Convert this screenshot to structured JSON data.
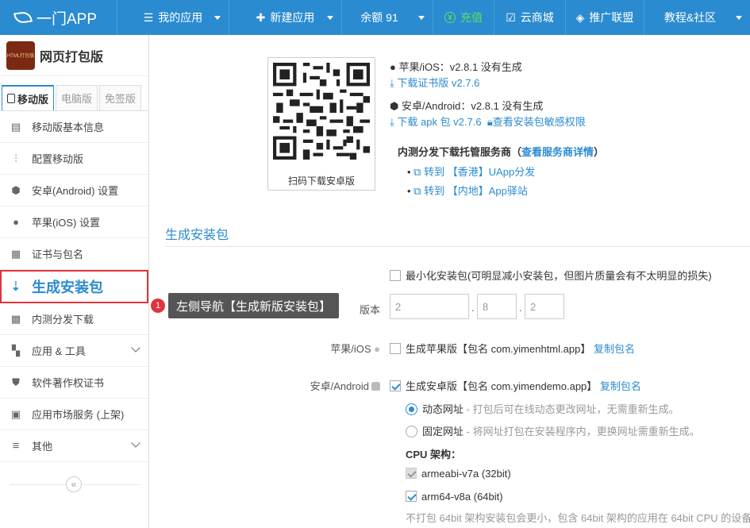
{
  "topbar": {
    "brand": "一门APP",
    "nav": [
      {
        "label": "我的应用",
        "icon": "menu-icon"
      },
      {
        "label": "新建应用",
        "icon": "plus-icon"
      },
      {
        "label": "余额 91",
        "icon": ""
      },
      {
        "label": "充值",
        "icon": "yen-icon"
      },
      {
        "label": "云商城",
        "icon": "shop-icon"
      },
      {
        "label": "推广联盟",
        "icon": "diamond-icon"
      },
      {
        "label": "教程&社区",
        "icon": ""
      }
    ],
    "recharge_color": "#5ddf5a"
  },
  "sidebar": {
    "app_icon_text": "HTML打包版",
    "app_name": "网页打包版",
    "tabs": [
      "移动版",
      "电脑版",
      "免签版"
    ],
    "items": [
      {
        "label": "移动版基本信息"
      },
      {
        "label": "配置移动版"
      },
      {
        "label": "安卓(Android) 设置"
      },
      {
        "label": "苹果(iOS) 设置"
      },
      {
        "label": "证书与包名"
      },
      {
        "label": "生成安装包"
      },
      {
        "label": "内测分发下载"
      },
      {
        "label": "应用 & 工具"
      },
      {
        "label": "软件著作权证书"
      },
      {
        "label": "应用市场服务 (上架)"
      },
      {
        "label": "其他"
      }
    ],
    "collapse_glyph": "«"
  },
  "tooltip": {
    "badge": "1",
    "text": "左侧导航【生成新版安装包】"
  },
  "main": {
    "qr_caption": "扫码下载安卓版",
    "ios_status": "苹果/iOS：v2.8.1 没有生成",
    "ios_download": "下载证书版 v2.7.6",
    "android_status": "安卓/Android：v2.8.1 没有生成",
    "android_download": "下载 apk 包 v2.7.6",
    "view_permissions": "查看安装包敏感权限",
    "dist_title": "内测分发下载托管服务商（",
    "dist_detail": "查看服务商详情",
    "dist_close": "）",
    "dist_links": [
      "转到 【香港】UApp分发",
      "转到 【内地】App驿站"
    ],
    "section_title": "生成安装包",
    "minimize_label": "最小化安装包(可明显减小安装包，但图片质量会有不太明显的损失)",
    "version_label": "版本",
    "version": [
      "2",
      "8",
      "2"
    ],
    "ios_label": "苹果/iOS",
    "ios_option": "生成苹果版【包名 com.yimenhtml.app】",
    "ios_copy": "复制包名",
    "android_label": "安卓/Android",
    "android_option": "生成安卓版【包名 com.yimendemo.app】",
    "android_copy": "复制包名",
    "dynamic_url": "动态网址",
    "dynamic_hint": "- 打包后可在线动态更改网址，无需重新生成。",
    "fixed_url": "固定网址",
    "fixed_hint": "- 将网址打包在安装程序内，更换网址需重新生成。",
    "cpu_title": "CPU 架构：",
    "cpu_options": [
      "armeabi-v7a (32bit)",
      "arm64-v8a (64bit)"
    ],
    "cpu_note": "不打包 64bit 架构安装包会更小，包含 64bit 架构的应用在 64bit CPU 的设备"
  }
}
